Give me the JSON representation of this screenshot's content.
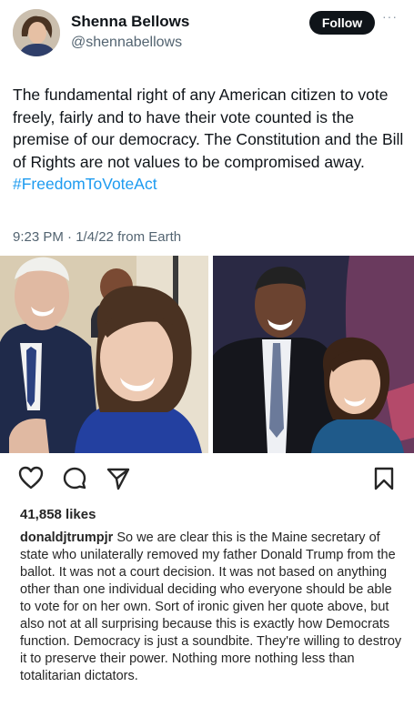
{
  "tweet": {
    "display_name": "Shenna Bellows",
    "handle": "@shennabellows",
    "follow_label": "Follow",
    "more_label": "···",
    "text": "The fundamental right of any American citizen to vote freely, fairly and to have their vote counted is the premise of our democracy. The Constitution and the Bill of Rights are not values to be compromised away. ",
    "hashtag": "#FreedomToVoteAct",
    "meta": "9:23 PM · 1/4/22 from Earth"
  },
  "instagram": {
    "likes": "41,858 likes",
    "caption_user": "donaldjtrumpjr",
    "caption_text": " So we are clear this is the Maine secretary of state who unilaterally removed my father Donald Trump from the ballot. It was not a court decision. It was not based on anything other than one individual deciding who everyone should be able to vote for on her own. Sort of ironic given her quote above, but also not at all surprising because this is exactly how Democrats function. Democracy is just a soundbite. They're willing to destroy it to preserve their power. Nothing more nothing less than totalitarian dictators."
  },
  "icons": [
    "like-icon",
    "comment-icon",
    "share-icon",
    "save-icon"
  ],
  "colors": {
    "hashtag": "#1d9bf0",
    "follow_bg": "#0f1419"
  }
}
